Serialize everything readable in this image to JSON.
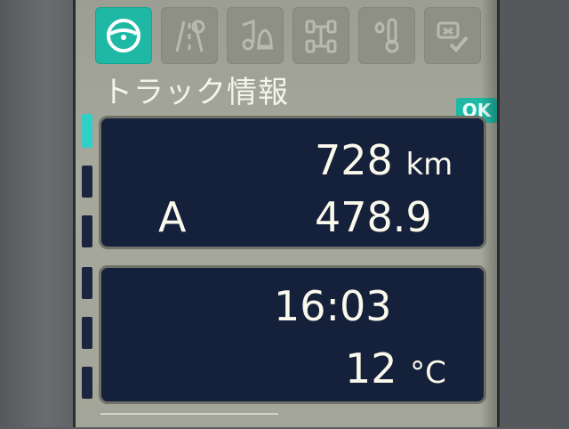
{
  "header": {
    "title": "トラック情報",
    "ok_label": "OK"
  },
  "tabs": [
    {
      "id": "steering-wheel-icon",
      "active": true
    },
    {
      "id": "road-icon",
      "active": false
    },
    {
      "id": "music-bell-icon",
      "active": false
    },
    {
      "id": "axle-icon",
      "active": false
    },
    {
      "id": "thermometer-drop-icon",
      "active": false
    },
    {
      "id": "settings-check-icon",
      "active": false
    }
  ],
  "trip": {
    "distance_value": "728",
    "distance_unit": "km",
    "trip_label": "A",
    "trip_value": "478.9"
  },
  "clock": {
    "time": "16:03",
    "temperature_value": "12",
    "temperature_unit": "°C"
  },
  "colors": {
    "accent": "#1fb8a5",
    "panel_bg": "#15203b",
    "screen_bg": "#a3a598",
    "text": "#fbf9ec"
  }
}
